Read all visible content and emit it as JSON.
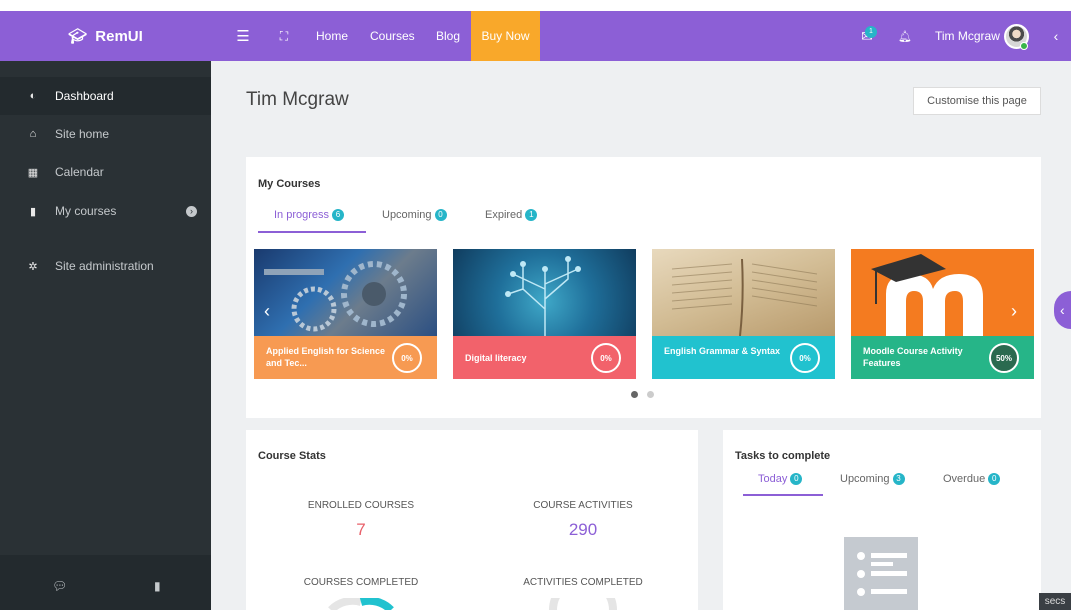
{
  "brand": {
    "name": "RemUI",
    "icon": "graduation-cap-icon"
  },
  "navbar": {
    "links": [
      "Home",
      "Courses",
      "Blog"
    ],
    "buy_now": "Buy Now",
    "message_count": "1",
    "username": "Tim Mcgraw"
  },
  "sidebar": {
    "items": [
      {
        "label": "Dashboard",
        "icon": "dashboard-icon"
      },
      {
        "label": "Site home",
        "icon": "home-icon"
      },
      {
        "label": "Calendar",
        "icon": "calendar-icon"
      },
      {
        "label": "My courses",
        "icon": "book-icon"
      },
      {
        "label": "Site administration",
        "icon": "gear-icon"
      }
    ]
  },
  "page": {
    "title": "Tim Mcgraw",
    "customise_label": "Customise this page"
  },
  "my_courses": {
    "title": "My Courses",
    "tabs": [
      {
        "label": "In progress",
        "count": "6"
      },
      {
        "label": "Upcoming",
        "count": "0"
      },
      {
        "label": "Expired",
        "count": "1"
      }
    ],
    "courses": [
      {
        "name": "Applied English for Science and Tec...",
        "progress": "0%",
        "color": "#f79a52"
      },
      {
        "name": "Digital literacy",
        "progress": "0%",
        "color": "#f2626b"
      },
      {
        "name": "English Grammar & Syntax",
        "progress": "0%",
        "color": "#21c2cf"
      },
      {
        "name": "Moodle Course Activity Features",
        "progress": "50%",
        "color": "#26b588"
      }
    ]
  },
  "course_stats": {
    "title": "Course Stats",
    "enrolled_label": "ENROLLED COURSES",
    "enrolled_value": "7",
    "activities_label": "COURSE ACTIVITIES",
    "activities_value": "290",
    "completed_label": "COURSES COMPLETED",
    "activities_completed_label": "ACTIVITIES COMPLETED"
  },
  "tasks": {
    "title": "Tasks to complete",
    "tabs": [
      {
        "label": "Today",
        "count": "0"
      },
      {
        "label": "Upcoming",
        "count": "3"
      },
      {
        "label": "Overdue",
        "count": "0"
      }
    ]
  },
  "footer_tag": "secs",
  "colors": {
    "accent": "#8c5fd6",
    "buy_now": "#f9a82a",
    "badge": "#26b5c8",
    "sidebar": "#2a3135"
  }
}
